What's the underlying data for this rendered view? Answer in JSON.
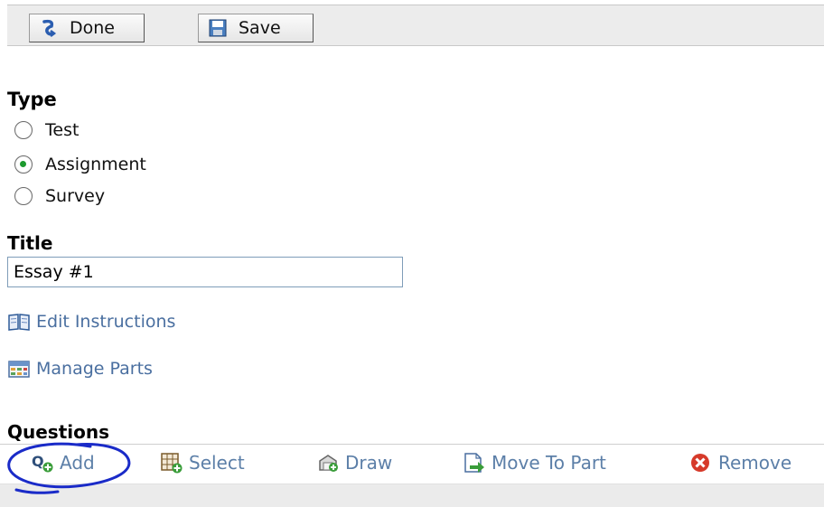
{
  "toolbar": {
    "done_label": "Done",
    "save_label": "Save"
  },
  "type_section": {
    "heading": "Type",
    "options": [
      {
        "label": "Test",
        "selected": false
      },
      {
        "label": "Assignment",
        "selected": true
      },
      {
        "label": "Survey",
        "selected": false
      }
    ]
  },
  "title_section": {
    "heading": "Title",
    "value": "Essay #1"
  },
  "links": {
    "edit_instructions": "Edit Instructions",
    "manage_parts": "Manage Parts"
  },
  "questions": {
    "heading": "Questions",
    "actions": {
      "add": "Add",
      "select": "Select",
      "draw": "Draw",
      "move_to_part": "Move To Part",
      "remove": "Remove"
    }
  },
  "colors": {
    "link": "#4a6fa0",
    "annotation": "#1a2bc8",
    "radio_selected": "#1c9a2e"
  }
}
